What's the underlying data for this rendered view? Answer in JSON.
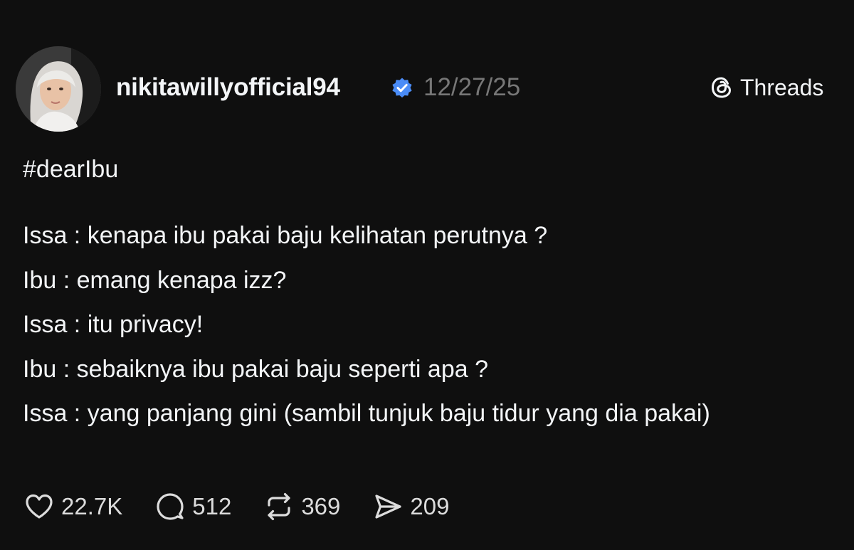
{
  "post": {
    "author": {
      "username": "nikitawillyofficial94",
      "verified": true
    },
    "timestamp": "12/27/25",
    "brand": {
      "label": "Threads",
      "icon": "threads-logo-icon"
    },
    "hashtag": "#dearIbu",
    "lines": [
      "Issa : kenapa ibu pakai baju kelihatan perutnya ?",
      "Ibu : emang kenapa izz?",
      "Issa : itu privacy!",
      "Ibu : sebaiknya ibu pakai baju seperti apa ?",
      "Issa : yang panjang gini (sambil tunjuk baju tidur yang dia pakai)"
    ],
    "actions": {
      "likes": {
        "icon": "heart-icon",
        "count": "22.7K"
      },
      "replies": {
        "icon": "comment-icon",
        "count": "512"
      },
      "reposts": {
        "icon": "repost-icon",
        "count": "369"
      },
      "shares": {
        "icon": "send-icon",
        "count": "209"
      }
    }
  },
  "colors": {
    "background": "#0f0f0f",
    "text": "#f3f5f7",
    "muted": "#777777",
    "verified": "#4a8cf7"
  }
}
